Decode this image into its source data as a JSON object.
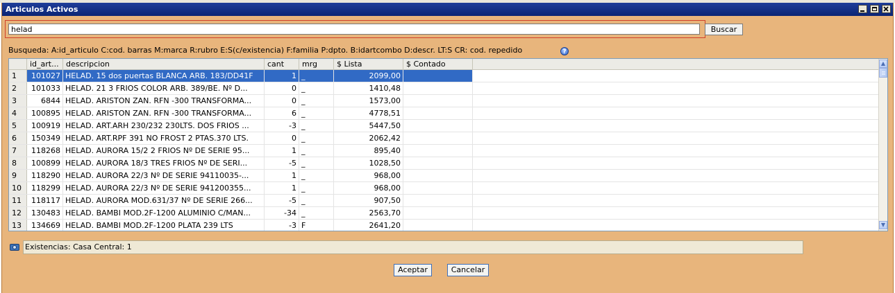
{
  "window": {
    "title": "Articulos Activos"
  },
  "search": {
    "value": "helad",
    "button_label": "Buscar",
    "help_text": "Busqueda: A:id_articulo C:cod. barras M:marca R:rubro E:S(c/existencia) F:familia P:dpto. B:idartcombo D:descr. LT:S CR: cod. repedido",
    "help_icon": "help-icon"
  },
  "table": {
    "columns": [
      "id_art...",
      "descripcion",
      "cant",
      "mrg",
      "$ Lista",
      "$ Contado"
    ],
    "selected_row": 1,
    "rows": [
      {
        "n": "1",
        "id": "101027",
        "desc": "HELAD. 15 dos puertas BLANCA ARB. 183/DD41F",
        "cant": "1",
        "mrg": "_",
        "lista": "2099,00",
        "contado": ""
      },
      {
        "n": "2",
        "id": "101033",
        "desc": "HELAD. 21 3 FRIOS COLOR ARB. 389/BE. Nº D...",
        "cant": "0",
        "mrg": "_",
        "lista": "1410,48",
        "contado": ""
      },
      {
        "n": "3",
        "id": "6844",
        "desc": "HELAD. ARISTON ZAN. RFN -300 TRANSFORMA...",
        "cant": "0",
        "mrg": "_",
        "lista": "1573,00",
        "contado": ""
      },
      {
        "n": "4",
        "id": "100895",
        "desc": "HELAD. ARISTON ZAN. RFN -300 TRANSFORMA...",
        "cant": "6",
        "mrg": "_",
        "lista": "4778,51",
        "contado": ""
      },
      {
        "n": "5",
        "id": "100919",
        "desc": "HELAD. ART.ARH 230/232 230LTS. DOS FRIOS ...",
        "cant": "-3",
        "mrg": "_",
        "lista": "5447,50",
        "contado": ""
      },
      {
        "n": "6",
        "id": "150349",
        "desc": "HELAD. ART.RPF 391 NO FROST 2 PTAS.370 LTS.",
        "cant": "0",
        "mrg": "_",
        "lista": "2062,42",
        "contado": ""
      },
      {
        "n": "7",
        "id": "118268",
        "desc": "HELAD. AURORA 15/2 2 FRIOS Nº DE SERIE 95...",
        "cant": "1",
        "mrg": "_",
        "lista": "895,40",
        "contado": ""
      },
      {
        "n": "8",
        "id": "100899",
        "desc": "HELAD. AURORA 18/3 TRES FRIOS Nº DE SERI...",
        "cant": "-5",
        "mrg": "_",
        "lista": "1028,50",
        "contado": ""
      },
      {
        "n": "9",
        "id": "118290",
        "desc": "HELAD. AURORA 22/3 Nº DE SERIE 94110035-...",
        "cant": "1",
        "mrg": "_",
        "lista": "968,00",
        "contado": ""
      },
      {
        "n": "10",
        "id": "118299",
        "desc": "HELAD. AURORA 22/3 Nº DE SERIE 941200355...",
        "cant": "1",
        "mrg": "_",
        "lista": "968,00",
        "contado": ""
      },
      {
        "n": "11",
        "id": "118117",
        "desc": "HELAD. AURORA MOD.631/37 Nº DE SERIE 266...",
        "cant": "-5",
        "mrg": "_",
        "lista": "907,50",
        "contado": ""
      },
      {
        "n": "12",
        "id": "130483",
        "desc": "HELAD. BAMBI MOD.2F-1200 ALUMINIO C/MAN...",
        "cant": "-34",
        "mrg": "_",
        "lista": "2563,70",
        "contado": ""
      },
      {
        "n": "13",
        "id": "134669",
        "desc": "HELAD. BAMBI MOD.2F-1200 PLATA 239 LTS",
        "cant": "-3",
        "mrg": "F",
        "lista": "2641,20",
        "contado": ""
      }
    ]
  },
  "status": {
    "icon": "camera-icon",
    "text": "Existencias: Casa Central: 1"
  },
  "actions": {
    "accept_label": "Aceptar",
    "cancel_label": "Cancelar"
  }
}
